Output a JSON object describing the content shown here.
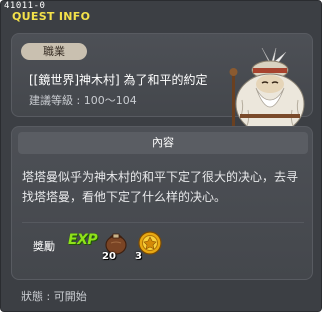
{
  "window": {
    "quest_id": "41011-0",
    "title": "QUEST INFO"
  },
  "quest": {
    "job_tag": "職業",
    "name": "[[鏡世界]神木村] 為了和平的約定",
    "level": "建議等級 : 100～104"
  },
  "content": {
    "header": "內容",
    "description": "塔塔曼似乎为神木村的和平下定了很大的决心，去寻找塔塔曼，看他下定了什么样的决心。",
    "reward_label": "獎勵",
    "exp_label": "EXP",
    "rewards": [
      {
        "icon": "brown-bag-item-icon",
        "count": "20"
      },
      {
        "icon": "gold-coin-item-icon",
        "count": "3"
      }
    ]
  },
  "footer": {
    "status": "狀態 : 可開始"
  },
  "colors": {
    "window_bg": "#3c3f44",
    "title": "#f4e24a",
    "exp": "#8fe21a",
    "job_tag_bg": "#c9c0b0"
  }
}
